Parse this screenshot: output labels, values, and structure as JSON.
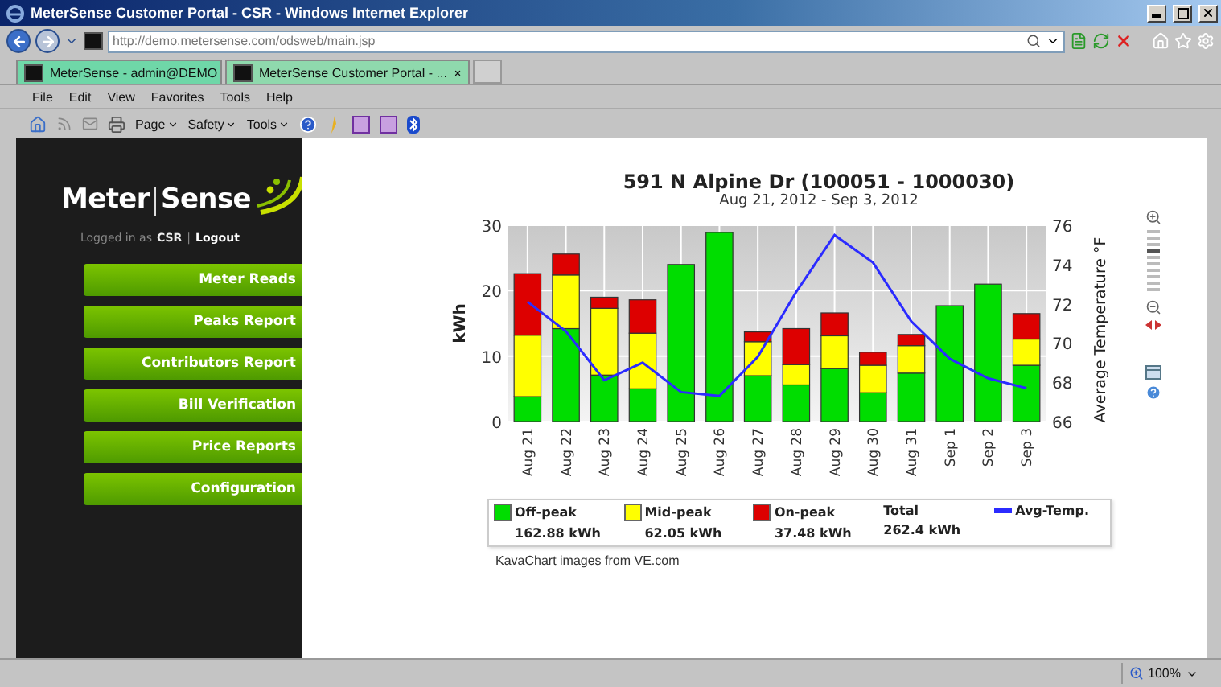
{
  "window": {
    "title": "MeterSense Customer Portal - CSR - Windows Internet Explorer"
  },
  "address_bar": {
    "url": "http://demo.metersense.com/odsweb/main.jsp"
  },
  "tabs": [
    {
      "label": "MeterSense - admin@DEMO",
      "selected": false
    },
    {
      "label": "MeterSense Customer Portal - ...",
      "selected": true
    }
  ],
  "menu_bar": [
    "File",
    "Edit",
    "View",
    "Favorites",
    "Tools",
    "Help"
  ],
  "command_bar": [
    "Page",
    "Safety",
    "Tools"
  ],
  "sidebar": {
    "brand_left": "Meter",
    "brand_right": "Sense",
    "logged_in_label": "Logged in as",
    "user": "CSR",
    "separator": "|",
    "logout": "Logout",
    "nav": [
      "Meter Reads",
      "Peaks Report",
      "Contributors Report",
      "Bill Verification",
      "Price Reports",
      "Configuration"
    ]
  },
  "chart": {
    "title": "591 N Alpine Dr (100051 - 1000030)",
    "subtitle": "Aug 21, 2012 - Sep 3, 2012",
    "chart_data": {
      "type": "bar",
      "stacked": true,
      "grid": true,
      "ylabel": "kWh",
      "ylim": [
        0,
        30
      ],
      "yticks": [
        0,
        10,
        20,
        30
      ],
      "categories": [
        "Aug 21",
        "Aug 22",
        "Aug 23",
        "Aug 24",
        "Aug 25",
        "Aug 26",
        "Aug 27",
        "Aug 28",
        "Aug 29",
        "Aug 30",
        "Aug 31",
        "Sep 1",
        "Sep 2",
        "Sep 3"
      ],
      "series": [
        {
          "name": "Off-peak",
          "color": "#00dd00",
          "type": "bar",
          "values": [
            3.8,
            14.2,
            7.1,
            5.0,
            24.0,
            28.9,
            7.0,
            5.6,
            8.1,
            4.4,
            7.4,
            17.7,
            21.0,
            8.6
          ]
        },
        {
          "name": "Mid-peak",
          "color": "#ffff00",
          "type": "bar",
          "values": [
            9.4,
            8.2,
            10.2,
            8.5,
            0,
            0,
            5.2,
            3.1,
            5.0,
            4.2,
            4.2,
            0,
            0,
            4.0
          ]
        },
        {
          "name": "On-peak",
          "color": "#dd0000",
          "type": "bar",
          "values": [
            9.4,
            3.2,
            1.7,
            5.1,
            0,
            0,
            1.5,
            5.5,
            3.5,
            2.0,
            1.7,
            0,
            0,
            3.9
          ]
        }
      ]
    },
    "temperature": {
      "chart_data": {
        "type": "line",
        "ylabel": "Average Temperature °F",
        "ylim": [
          66,
          76
        ],
        "yticks": [
          66,
          68,
          70,
          72,
          74,
          76
        ],
        "series": [
          {
            "name": "Avg-Temp.",
            "color": "#2b2bff",
            "values": [
              72.1,
              70.6,
              68.1,
              69.0,
              67.5,
              67.3,
              69.3,
              72.6,
              75.5,
              74.1,
              71.1,
              69.2,
              68.2,
              67.7
            ]
          }
        ]
      }
    },
    "legend_values": [
      "162.88 kWh",
      "62.05 kWh",
      "37.48 kWh"
    ],
    "legend_total": {
      "label": "Total",
      "value": "262.4 kWh"
    },
    "credit": "KavaChart images from VE.com"
  },
  "status_bar": {
    "zoom": "100%"
  }
}
